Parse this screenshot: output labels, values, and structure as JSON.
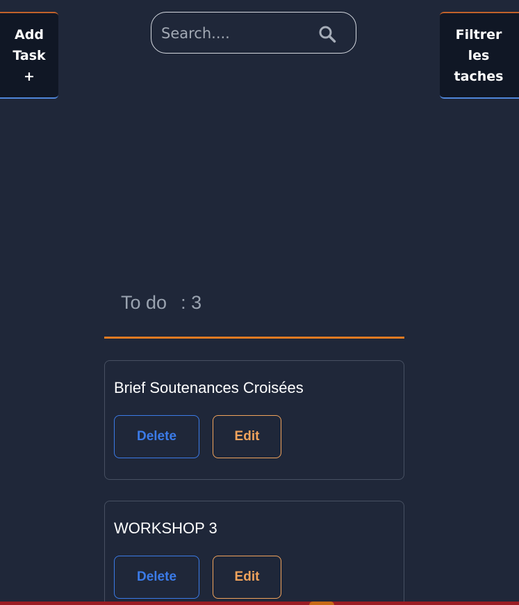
{
  "header": {
    "add_task_label": "Add\nTask\n+",
    "filter_label": "Filtrer\nles\ntaches",
    "search": {
      "placeholder": "Search....",
      "value": "",
      "icon": "search-icon"
    }
  },
  "column": {
    "title": "To do",
    "count": ": 3",
    "accent_color": "#e07a22"
  },
  "cards": [
    {
      "title": "Brief Soutenances Croisées",
      "delete_label": "Delete",
      "edit_label": "Edit"
    },
    {
      "title": "WORKSHOP 3",
      "delete_label": "Delete",
      "edit_label": "Edit"
    }
  ],
  "colors": {
    "background": "#1f2739",
    "delete": "#3b7be8",
    "edit": "#f0a35c"
  }
}
